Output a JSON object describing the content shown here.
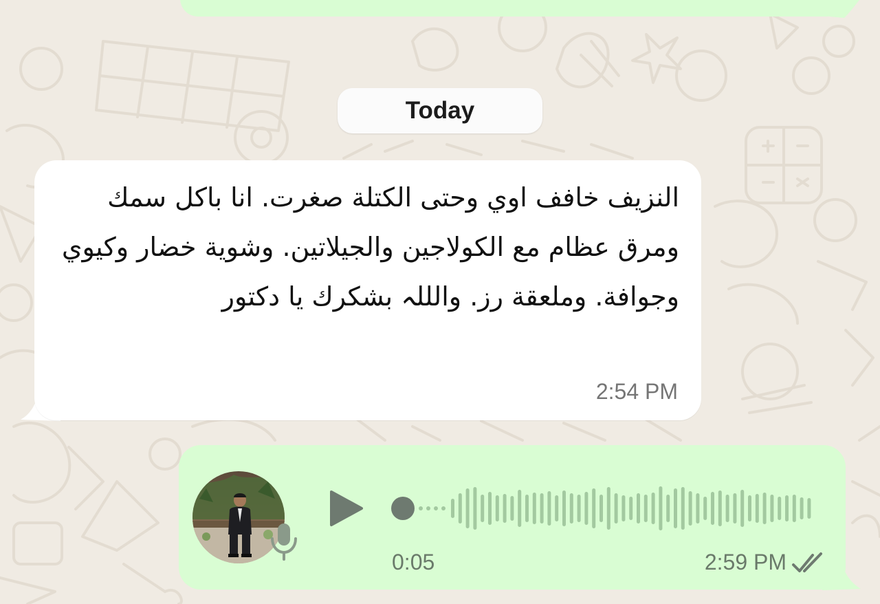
{
  "date_chip": {
    "label": "Today"
  },
  "incoming_message": {
    "text": "النزيف خافف اوي وحتى الكتلة صغرت. انا باكل سمك ومرق عظام مع الكولاجين والجيلاتين. وشوية خضار وكيوي وجوافة. وملعقة رز. والللہ بشكرك يا دكتور",
    "time": "2:54 PM"
  },
  "voice_message": {
    "duration": "0:05",
    "time": "2:59 PM",
    "status": "read",
    "progress": 0,
    "icons": {
      "play": "play-icon",
      "mic": "microphone-icon",
      "status": "double-check-icon"
    }
  },
  "colors": {
    "wallpaper": "#f0ebe3",
    "doodle": "#e3dcd1",
    "incoming_bubble": "#ffffff",
    "outgoing_bubble": "#d9fdd3",
    "waveform": "#a3c9a0",
    "play": "#6e7a70",
    "timestamp": "#757575"
  }
}
